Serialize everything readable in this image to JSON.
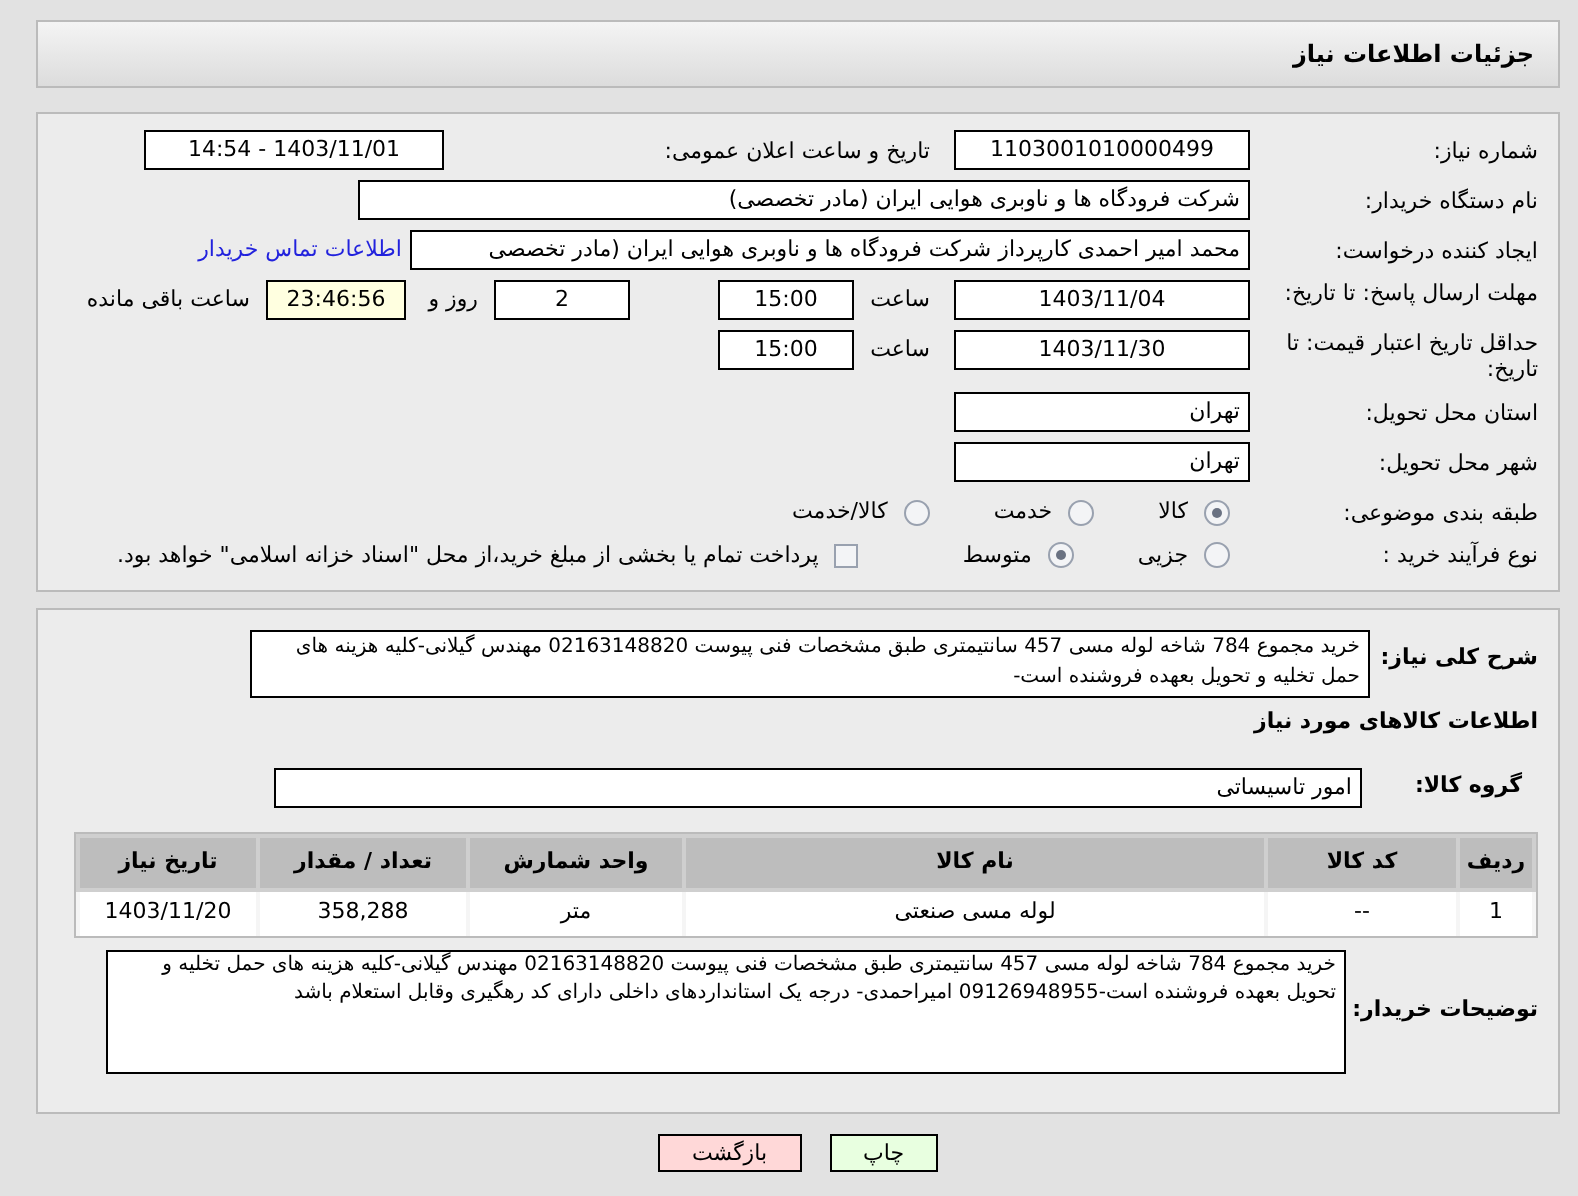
{
  "header": {
    "title": "جزئیات اطلاعات نیاز"
  },
  "need_number": {
    "label": "شماره نیاز:",
    "value": "1103001010000499"
  },
  "announce": {
    "label": "تاریخ و ساعت اعلان عمومی:",
    "value": "1403/11/01 - 14:54"
  },
  "buyer_org": {
    "label": "نام دستگاه خریدار:",
    "value": "شرکت فرودگاه ها و ناوبری هوایی ایران (مادر تخصصی)"
  },
  "requester": {
    "label": "ایجاد کننده درخواست:",
    "value": "محمد امیر احمدی کارپرداز شرکت فرودگاه ها و ناوبری هوایی ایران (مادر تخصصی",
    "link": "اطلاعات تماس خریدار"
  },
  "deadline": {
    "label": "مهلت ارسال پاسخ: تا تاریخ:",
    "date": "1403/11/04",
    "time_label": "ساعت",
    "time": "15:00",
    "days": "2",
    "days_label": "روز و",
    "remaining": "23:46:56",
    "remaining_label": "ساعت باقی مانده"
  },
  "validity": {
    "label": "حداقل تاریخ اعتبار قیمت: تا تاریخ:",
    "date": "1403/11/30",
    "time_label": "ساعت",
    "time": "15:00"
  },
  "province": {
    "label": "استان محل تحویل:",
    "value": "تهران"
  },
  "city": {
    "label": "شهر محل تحویل:",
    "value": "تهران"
  },
  "category": {
    "label": "طبقه بندی موضوعی:",
    "options": [
      {
        "label": "کالا",
        "selected": true
      },
      {
        "label": "خدمت",
        "selected": false
      },
      {
        "label": "کالا/خدمت",
        "selected": false
      }
    ]
  },
  "process": {
    "label": "نوع فرآیند خرید :",
    "options": [
      {
        "label": "جزیی",
        "selected": false
      },
      {
        "label": "متوسط",
        "selected": true
      }
    ],
    "payment": {
      "label": "پرداخت تمام یا بخشی از مبلغ خرید،از محل \"اسناد خزانه اسلامی\" خواهد بود.",
      "checked": false
    }
  },
  "summary": {
    "label": "شرح کلی نیاز:",
    "value": "خرید مجموع 784 شاخه لوله مسی 457 سانتیمتری طبق مشخصات فنی پیوست 02163148820 مهندس گیلانی-کلیه هزینه های حمل تخلیه و تحویل بعهده فروشنده است-"
  },
  "goods_title": "اطلاعات کالاهای مورد نیاز",
  "goods_group": {
    "label": "گروه کالا:",
    "value": "امور تاسیساتی"
  },
  "table": {
    "columns": [
      "ردیف",
      "کد کالا",
      "نام کالا",
      "واحد شمارش",
      "تعداد / مقدار",
      "تاریخ نیاز"
    ],
    "rows": [
      [
        "1",
        "--",
        "لوله مسی صنعتی",
        "متر",
        "358,288",
        "1403/11/20"
      ]
    ]
  },
  "buyer_notes": {
    "label": "توضیحات خریدار:",
    "value": "خرید مجموع 784 شاخه لوله مسی 457 سانتیمتری طبق مشخصات فنی پیوست 02163148820 مهندس گیلانی-کلیه هزینه های حمل تخلیه و تحویل بعهده فروشنده است-09126948955 امیراحمدی- درجه یک استانداردهای داخلی دارای کد رهگیری وقابل استعلام باشد"
  },
  "buttons": [
    {
      "label": "چاپ",
      "kind": "print"
    },
    {
      "label": "بازگشت",
      "kind": "back"
    }
  ]
}
